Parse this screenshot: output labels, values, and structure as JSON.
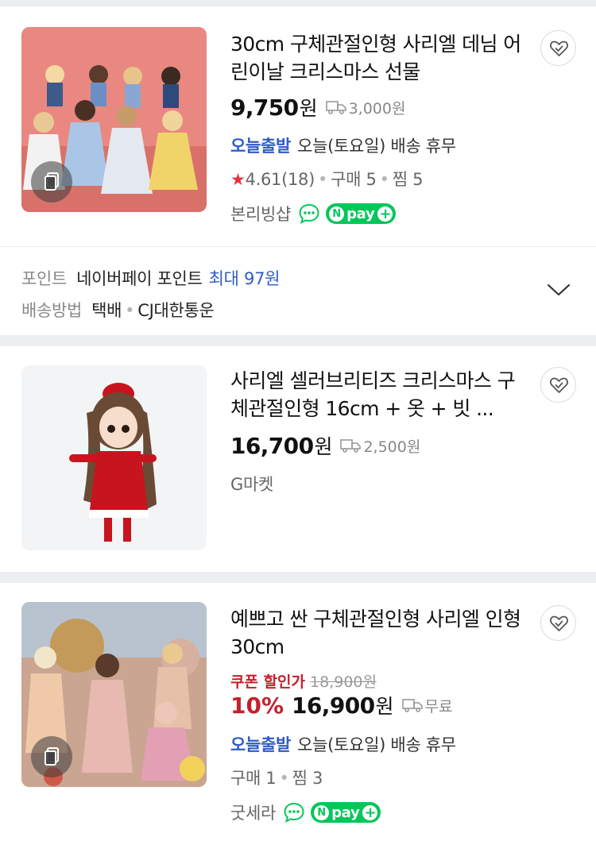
{
  "products": [
    {
      "title": "30cm 구체관절인형 사리엘 데님 어린이날 크리스마스 선물",
      "price": "9,750",
      "currency": "원",
      "shipping": "3,000원",
      "today_tag": "오늘출발",
      "today_text": "오늘(토요일) 배송 휴무",
      "rating": "4.61",
      "review_count": "(18)",
      "purchase": "구매 5",
      "wish": "찜 5",
      "seller": "본리빙샵",
      "npay_label": "pay"
    },
    {
      "title": "사리엘 셀러브리티즈 크리스마스 구체관절인형 16cm + 옷 + 빗 ...",
      "price": "16,700",
      "currency": "원",
      "shipping": "2,500원",
      "seller": "G마켓"
    },
    {
      "title": "예쁘고 싼 구체관절인형 사리엘 인형 30cm",
      "coupon_tag": "쿠폰 할인가",
      "original_price": "18,900원",
      "discount": "10%",
      "price": "16,900",
      "currency": "원",
      "shipping": "무료",
      "today_tag": "오늘출발",
      "today_text": "오늘(토요일) 배송 휴무",
      "purchase": "구매 1",
      "wish": "찜 3",
      "seller": "굿세라",
      "npay_label": "pay"
    }
  ],
  "info": {
    "point_key": "포인트",
    "point_val": "네이버페이 포인트",
    "point_hl": "최대 97원",
    "delivery_key": "배송방법",
    "delivery_val": "택배",
    "delivery_carrier": "CJ대한통운"
  },
  "colors": {
    "accent_blue": "#2f5bc6",
    "naver_green": "#03c75a",
    "sale_red": "#c4202c",
    "star_red": "#e8323c"
  },
  "icons": [
    "heart-check-icon",
    "truck-icon",
    "star-icon",
    "talk-icon",
    "npay-logo",
    "chevron-down-icon",
    "multi-image-icon"
  ]
}
